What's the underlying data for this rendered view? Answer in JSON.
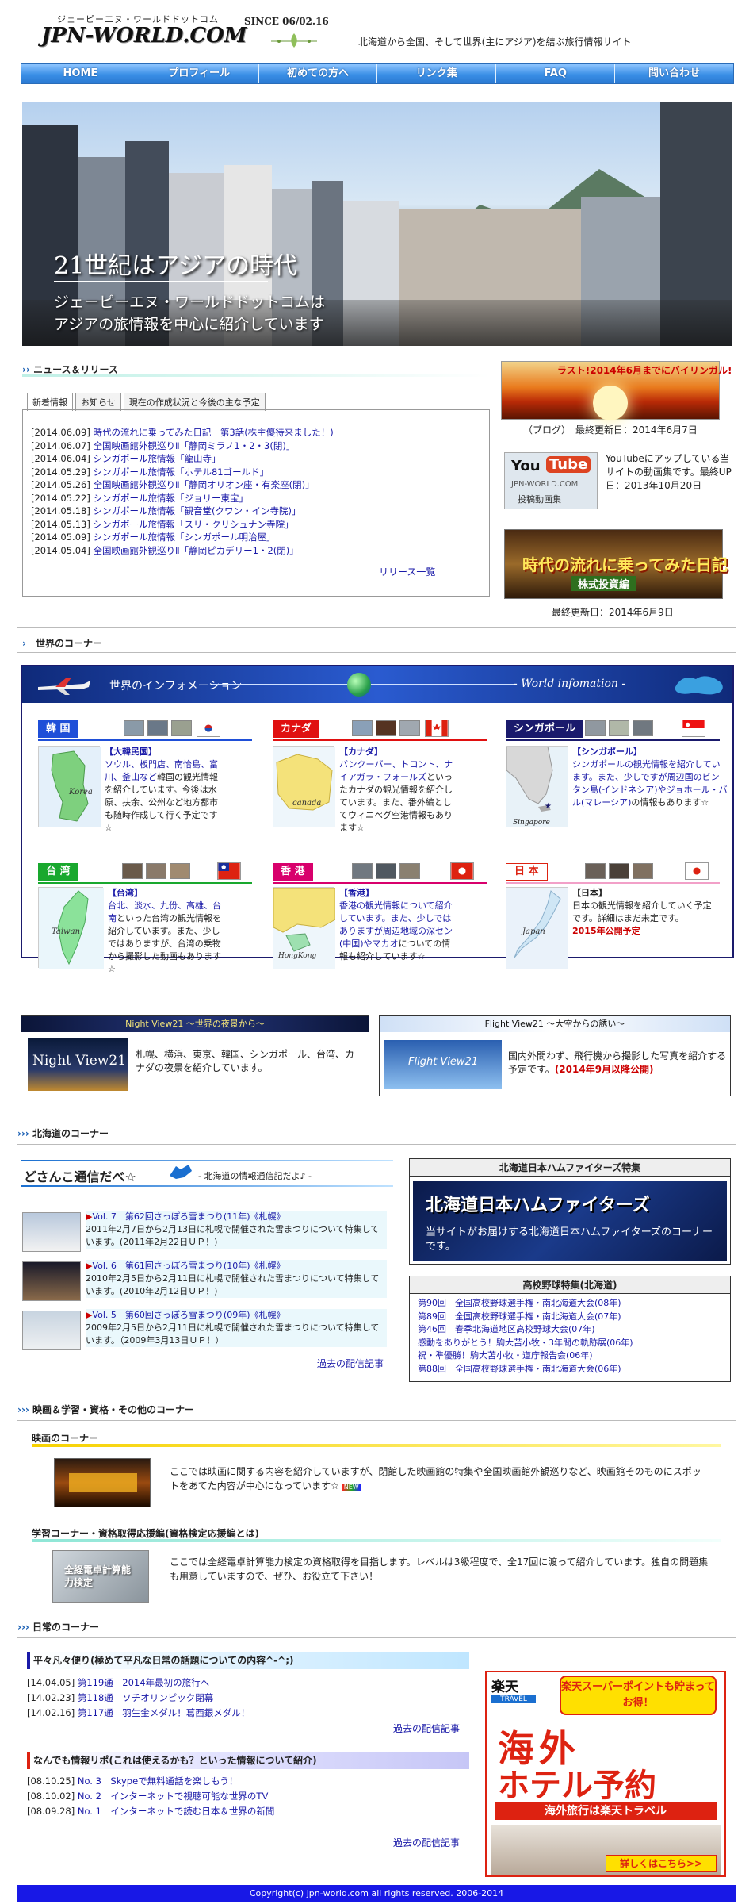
{
  "header": {
    "logo_kana": "ジェーピーエヌ・ワールドドットコム",
    "logo_text": "JPN-WORLD.COM",
    "since": "SINCE 06/02.16",
    "tagline": "北海道から全国、そして世界(主にアジア)を結ぶ旅行情報サイト"
  },
  "nav": [
    "HOME",
    "プロフィール",
    "初めての方へ",
    "リンク集",
    "FAQ",
    "問い合わせ"
  ],
  "hero": {
    "headline": "21世紀はアジアの時代",
    "line1": "ジェーピーエヌ・ワールドドットコムは",
    "line2": "アジアの旅情報を中心に紹介しています"
  },
  "news": {
    "section_title": "ニュース＆リリース",
    "tabs": [
      "新着情報",
      "お知らせ",
      "現在の作成状況と今後の主な予定"
    ],
    "items": [
      {
        "date": "[2014.06.09]",
        "text": "時代の流れに乗ってみた日記　第3話(株主優待来ました！)"
      },
      {
        "date": "[2014.06.07]",
        "text": "全国映画館外観巡りⅡ「静岡ミラノ1・2・3(閉)」"
      },
      {
        "date": "[2014.06.04]",
        "text": "シンガポール旅情報「龍山寺」"
      },
      {
        "date": "[2014.05.29]",
        "text": "シンガポール旅情報「ホテル81ゴールド」"
      },
      {
        "date": "[2014.05.26]",
        "text": "全国映画館外観巡りⅡ「静岡オリオン座・有楽座(閉)」"
      },
      {
        "date": "[2014.05.22]",
        "text": "シンガポール旅情報「ジョリー東宝」"
      },
      {
        "date": "[2014.05.18]",
        "text": "シンガポール旅情報「観音堂(クワン・イン寺院)」"
      },
      {
        "date": "[2014.05.13]",
        "text": "シンガポール旅情報「スリ・クリシュナン寺院」"
      },
      {
        "date": "[2014.05.09]",
        "text": "シンガポール旅情報「シンガポール明治屋」"
      },
      {
        "date": "[2014.05.04]",
        "text": "全国映画館外観巡りⅡ「静岡ピカデリー1・2(閉)」"
      }
    ],
    "more": "リリース一覧"
  },
  "right": {
    "blog_banner": "ラスト!2014年6月までにバイリンガル!",
    "blog_caption": "（ブログ）　最終更新日：2014年6月7日",
    "yt_you": "You",
    "yt_tube": "Tube",
    "yt_site": "JPN-WORLD.COM",
    "yt_label": "投稿動画集",
    "yt_text": "YouTubeにアップしている当サイトの動画集です。最終UP日：2013年10月20日",
    "diary_title": "時代の流れに乗ってみた日記",
    "diary_sub": "株式投資編",
    "diary_caption": "最終更新日：2014年6月9日"
  },
  "world_section": "世界のコーナー",
  "world": {
    "banner": "世界のインフォメーション",
    "banner_en": "- World infomation -",
    "countries": [
      {
        "tab": "韓 国",
        "color": "#1f4fd8",
        "name": "【大韓民国】",
        "map": "Korea",
        "text_link": "ソウル、板門店、南怡島、富川、釜山など",
        "text": "韓国の観光情報を紹介しています。今後は水原、扶余、公州など地方都市も随時作成して行く予定です☆"
      },
      {
        "tab": "カナダ",
        "color": "#e01010",
        "name": "【カナダ】",
        "map": "canada",
        "text_link": "バンクーバー、トロント、ナイアガラ・フォールズ",
        "text": "といったカナダの観光情報を紹介しています。また、番外編としてウィニペグ空港情報もあります☆"
      },
      {
        "tab": "シンガポール",
        "color": "#1a1a6c",
        "name": "【シンガポール】",
        "map": "Singapore",
        "text_link": "シンガポールの観光情報を紹介しています。また、少しですが周辺国のビンタン島(インドネシア)やジョホール・バル(マレーシア)",
        "text": "の情報もあります☆"
      },
      {
        "tab": "台 湾",
        "color": "#19a82e",
        "name": "【台湾】",
        "map": "Taiwan",
        "text_link": "台北、淡水、九份、高雄、台南",
        "text": "といった台湾の観光情報を紹介しています。また、少しではありますが、台湾の乗物から撮影した動画もあります☆"
      },
      {
        "tab": "香 港",
        "color": "#d8006c",
        "name": "【香港】",
        "map": "HongKong",
        "text_link": "香港の観光情報について紹介しています。また、少しではありますが周辺地域の深セン(中国)やマカオ",
        "text": "についての情報も紹介しています☆"
      },
      {
        "tab": "日 本",
        "color": "#ffffff",
        "name": "【日本】",
        "map": "Japan",
        "text_link": "",
        "text": "日本の観光情報を紹介していく予定です。詳細はまだ未定です。",
        "note": "2015年公開予定"
      }
    ]
  },
  "night": {
    "title": "Night View21 〜世界の夜景から〜",
    "logo": "Night View21",
    "text": "札幌、横浜、東京、韓国、シンガポール、台湾、カナダの夜景を紹介しています。"
  },
  "flight": {
    "title": "Flight View21 〜大空からの誘い〜",
    "logo": "Flight View21",
    "text": "国内外問わず、飛行機から撮影した写真を紹介する予定です。",
    "note": "(2014年9月以降公開)"
  },
  "hokkaido_section": "北海道のコーナー",
  "dosanko": {
    "title": "どさんこ通信だべ☆",
    "subtitle": "- 北海道の情報通信記だよ♪ -",
    "vols": [
      {
        "head": "Vol. 7　第62回さっぽろ雪まつり(11年)《札幌》",
        "body": "2011年2月7日から2月13日に札幌で開催された雪まつりについて特集しています。(2011年2月22日ＵＰ！)"
      },
      {
        "head": "Vol. 6　第61回さっぽろ雪まつり(10年)《札幌》",
        "body": "2010年2月5日から2月11日に札幌で開催された雪まつりについて特集しています。(2010年2月12日ＵＰ！)"
      },
      {
        "head": "Vol. 5　第60回さっぽろ雪まつり(09年)《札幌》",
        "body": "2009年2月5日から2月11日に札幌で開催された雪まつりについて特集しています。（2009年3月13日ＵＰ！）"
      }
    ],
    "more": "過去の配信記事"
  },
  "fighters": {
    "box_title": "北海道日本ハムファイターズ特集",
    "banner_title": "北海道日本ハムファイターズ",
    "banner_text": "当サイトがお届けする北海道日本ハムファイターズのコーナーです。"
  },
  "baseball": {
    "box_title": "高校野球特集(北海道)",
    "items": [
      "第90回　全国高校野球選手権・南北海道大会(08年)",
      "第89回　全国高校野球選手権・南北海道大会(07年)",
      "第46回　春季北海道地区高校野球大会(07年)",
      "感動をありがとう！駒大苫小牧・3年間の軌跡展(06年)",
      "祝・準優勝！駒大苫小牧・道庁報告会(06年)",
      "第88回　全国高校野球選手権・南北海道大会(06年)"
    ]
  },
  "movie_section": "映画＆学習・資格・その他のコーナー",
  "movie": {
    "title": "映画のコーナー",
    "text": "ここでは映画に関する内容を紹介していますが、閉館した映画館の特集や全国映画館外観巡りなど、映画館そのものにスポットをあてた内容が中心になっています☆",
    "badge": "NEW"
  },
  "study": {
    "title": "学習コーナー・資格取得応援編(資格検定応援編とは)",
    "text": "ここでは全経電卓計算能力検定の資格取得を目指します。レベルは3級程度で、全17回に渡って紹介しています。独自の問題集も用意していますので、ぜひ、お役立て下さい！",
    "img_text": "全経電卓計算能力検定"
  },
  "daily_section": "日常のコーナー",
  "heibon": {
    "title": "平々凡々便り(極めて平凡な日常の話題についての内容^-^;)",
    "items": [
      {
        "date": "[14.04.05]",
        "no": "第119通",
        "text": "2014年最初の旅行へ"
      },
      {
        "date": "[14.02.23]",
        "no": "第118通",
        "text": "ソチオリンピック閉幕"
      },
      {
        "date": "[14.02.16]",
        "no": "第117通",
        "text": "羽生金メダル！葛西銀メダル！"
      }
    ],
    "more": "過去の配信記事"
  },
  "nandemo": {
    "title": "なんでも情報リポ(これは使えるかも？といった情報について紹介)",
    "items": [
      {
        "date": "[08.10.25]",
        "no": "No. 3",
        "text": "Skypeで無料通話を楽しもう！"
      },
      {
        "date": "[08.10.02]",
        "no": "No. 2",
        "text": "インターネットで視聴可能な世界のTV"
      },
      {
        "date": "[08.09.28]",
        "no": "No. 1",
        "text": "インターネットで読む日本＆世界の新聞"
      }
    ],
    "more": "過去の配信記事"
  },
  "ad": {
    "brand": "楽天",
    "brand_sub": "TRAVEL",
    "points": "楽天スーパーポイントも貯まってお得！",
    "main1": "海外",
    "main2": "ホテル予約",
    "sub": "海外旅行は楽天トラベル",
    "cta": "詳しくはこちら>>"
  },
  "footer": "Copyright(c) jpn-world.com all rights reserved. 2006-2014"
}
